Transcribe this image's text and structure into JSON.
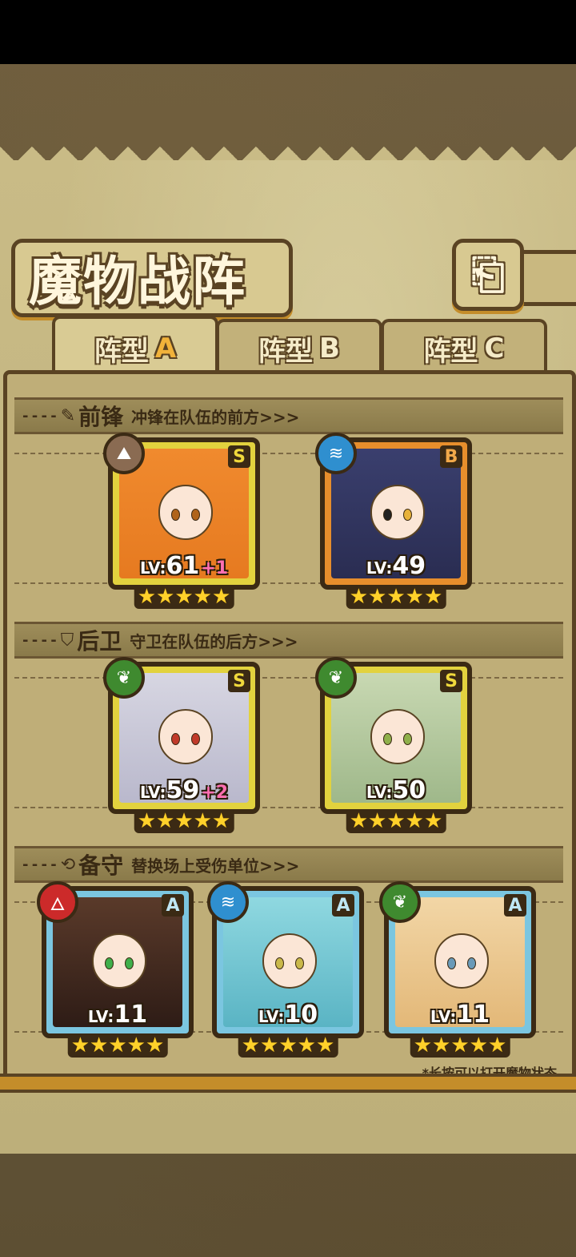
{
  "title": "魔物战阵",
  "back_icon": "back-arrow-icon",
  "tabs": [
    {
      "label": "阵型",
      "letter": "A",
      "active": true
    },
    {
      "label": "阵型",
      "letter": "B",
      "active": false
    },
    {
      "label": "阵型",
      "letter": "C",
      "active": false
    }
  ],
  "sections": {
    "front": {
      "title": "前锋",
      "desc": "冲锋在队伍的前方>>>",
      "icon": "sword-icon"
    },
    "back": {
      "title": "后卫",
      "desc": "守卫在队伍的后方>>>",
      "icon": "shield-icon"
    },
    "reserve": {
      "title": "备守",
      "desc": "替换场上受伤单位>>>",
      "icon": "swap-icon"
    }
  },
  "cards": {
    "front1": {
      "rarity": "S",
      "element": "earth",
      "lv_prefix": "LV:",
      "level": "61",
      "bonus": "+1",
      "stars": "★★★★★"
    },
    "front2": {
      "rarity": "B",
      "element": "water",
      "lv_prefix": "LV:",
      "level": "49",
      "bonus": "",
      "stars": "★★★★★"
    },
    "back1": {
      "rarity": "S",
      "element": "wood",
      "lv_prefix": "LV:",
      "level": "59",
      "bonus": "+2",
      "stars": "★★★★★"
    },
    "back2": {
      "rarity": "S",
      "element": "wood",
      "lv_prefix": "LV:",
      "level": "50",
      "bonus": "",
      "stars": "★★★★★"
    },
    "res1": {
      "rarity": "A",
      "element": "fire",
      "lv_prefix": "LV:",
      "level": "11",
      "bonus": "",
      "stars": "★★★★★"
    },
    "res2": {
      "rarity": "A",
      "element": "water",
      "lv_prefix": "LV:",
      "level": "10",
      "bonus": "",
      "stars": "★★★★★"
    },
    "res3": {
      "rarity": "A",
      "element": "wood",
      "lv_prefix": "LV:",
      "level": "11",
      "bonus": "",
      "stars": "★★★★★"
    }
  },
  "footnote": "*长按可以打开魔物状态",
  "colors": {
    "accent": "#f1b23a",
    "frame": "#5a4323",
    "paper": "#c9bb86"
  }
}
